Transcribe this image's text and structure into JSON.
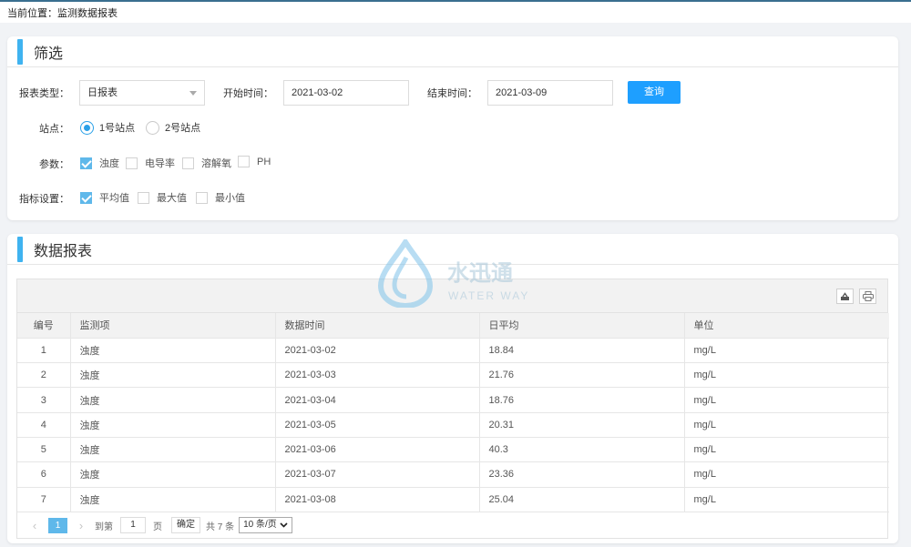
{
  "breadcrumb": "当前位置：监测数据报表",
  "filter": {
    "title": "筛选",
    "report_type_label": "报表类型：",
    "report_type_value": "日报表",
    "start_label": "开始时间：",
    "start_value": "2021-03-02",
    "end_label": "结束时间：",
    "end_value": "2021-03-09",
    "query_label": "查询",
    "station_label": "站点：",
    "stations": [
      {
        "label": "1号站点",
        "selected": true
      },
      {
        "label": "2号站点",
        "selected": false
      }
    ],
    "param_label": "参数：",
    "params": [
      {
        "label": "浊度",
        "checked": true
      },
      {
        "label": "电导率",
        "checked": false
      },
      {
        "label": "溶解氧",
        "checked": false
      },
      {
        "label": "PH",
        "checked": false
      }
    ],
    "indicator_label": "指标设置：",
    "indicators": [
      {
        "label": "平均值",
        "checked": true
      },
      {
        "label": "最大值",
        "checked": false
      },
      {
        "label": "最小值",
        "checked": false
      }
    ]
  },
  "report": {
    "title": "数据报表",
    "columns": [
      "编号",
      "监测项",
      "数据时间",
      "日平均",
      "单位"
    ],
    "rows": [
      [
        "1",
        "浊度",
        "2021-03-02",
        "18.84",
        "mg/L"
      ],
      [
        "2",
        "浊度",
        "2021-03-03",
        "21.76",
        "mg/L"
      ],
      [
        "3",
        "浊度",
        "2021-03-04",
        "18.76",
        "mg/L"
      ],
      [
        "4",
        "浊度",
        "2021-03-05",
        "20.31",
        "mg/L"
      ],
      [
        "5",
        "浊度",
        "2021-03-06",
        "40.3",
        "mg/L"
      ],
      [
        "6",
        "浊度",
        "2021-03-07",
        "23.36",
        "mg/L"
      ],
      [
        "7",
        "浊度",
        "2021-03-08",
        "25.04",
        "mg/L"
      ]
    ],
    "pager": {
      "prev": "‹",
      "current_page": "1",
      "next": "›",
      "goto_label": "到第",
      "goto_value": "1",
      "page_unit": "页",
      "confirm": "确定",
      "total": "共 7 条",
      "per_page": "10 条/页"
    }
  },
  "watermark": {
    "name": "水迅通",
    "sub": "WATER WAY"
  },
  "colors": {
    "accent": "#3fb3f0",
    "button": "#1e9fff",
    "check": "#5fb8ea"
  }
}
